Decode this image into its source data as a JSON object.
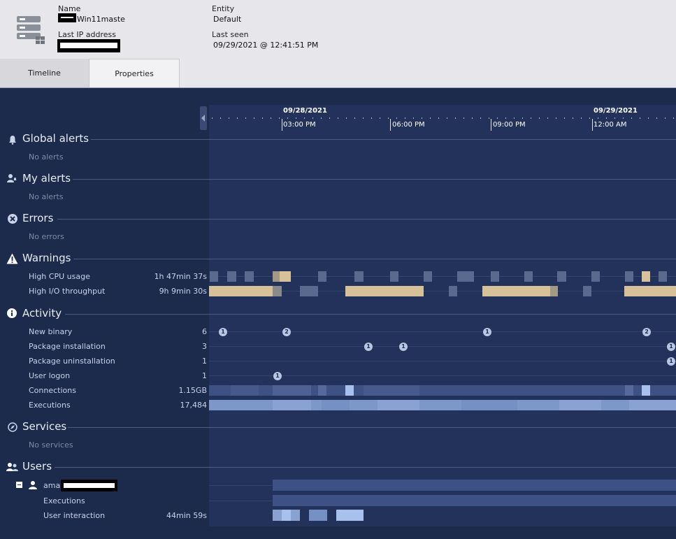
{
  "header": {
    "name_label": "Name",
    "name_value": "Win11maste",
    "last_ip_label": "Last IP address",
    "entity_label": "Entity",
    "entity_value": "Default",
    "last_seen_label": "Last seen",
    "last_seen_value": "09/29/2021 @ 12:41:51 PM"
  },
  "tabs": {
    "timeline": "Timeline",
    "properties": "Properties"
  },
  "timeline": {
    "dates": [
      "09/28/2021",
      "09/29/2021"
    ],
    "times": [
      "03:00 PM",
      "06:00 PM",
      "09:00 PM",
      "12:00 AM"
    ]
  },
  "sections": {
    "global_alerts": {
      "title": "Global alerts",
      "empty": "No alerts"
    },
    "my_alerts": {
      "title": "My alerts",
      "empty": "No alerts"
    },
    "errors": {
      "title": "Errors",
      "empty": "No errors"
    },
    "warnings": {
      "title": "Warnings",
      "rows": [
        {
          "label": "High CPU usage",
          "value": "1h 47min 37s"
        },
        {
          "label": "High I/O throughput",
          "value": "9h 9min 30s"
        }
      ]
    },
    "activity": {
      "title": "Activity",
      "rows": [
        {
          "label": "New binary",
          "value": "6"
        },
        {
          "label": "Package installation",
          "value": "3"
        },
        {
          "label": "Package uninstallation",
          "value": "1"
        },
        {
          "label": "User logon",
          "value": "1"
        },
        {
          "label": "Connections",
          "value": "1.15GB"
        },
        {
          "label": "Executions",
          "value": "17,484"
        }
      ],
      "badges": {
        "new_binary": [
          "1",
          "2",
          "1",
          "2"
        ],
        "package_installation": [
          "1",
          "1",
          "1"
        ],
        "package_uninstallation": [
          "1"
        ],
        "user_logon": [
          "1"
        ]
      }
    },
    "services": {
      "title": "Services",
      "empty": "No services"
    },
    "users": {
      "title": "Users",
      "user_name": "amal",
      "rows": [
        {
          "label": "Executions",
          "value": ""
        },
        {
          "label": "User interaction",
          "value": "44min 59s"
        }
      ]
    }
  },
  "colors": {
    "background": "#1c2a4b",
    "chart_background": "#23325a",
    "warning_tan": "#d6c19a",
    "activity_blue": "#7e97c9",
    "badge": "#b8c6e6"
  }
}
